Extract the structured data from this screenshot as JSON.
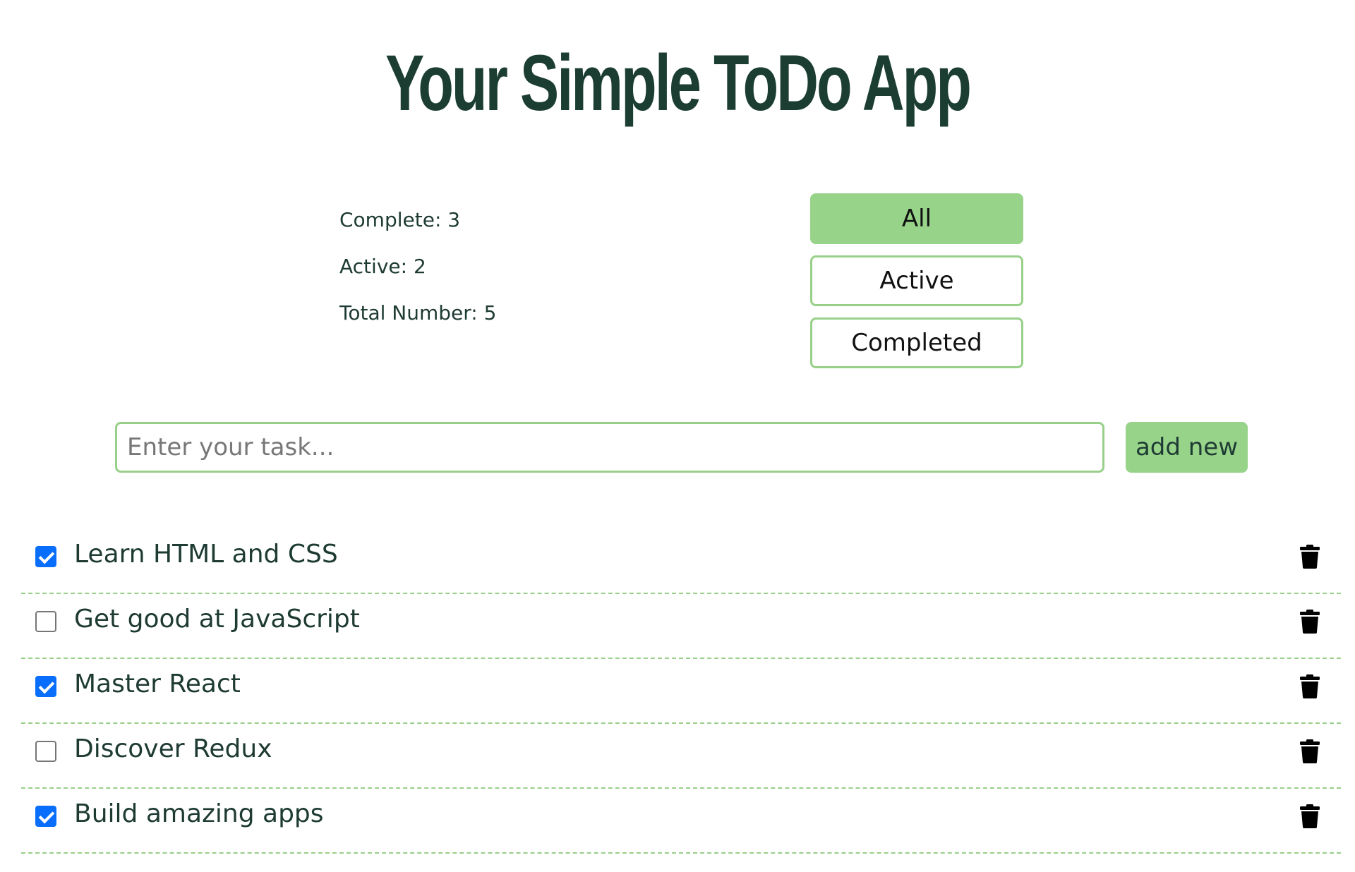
{
  "app": {
    "title": "Your Simple ToDo App"
  },
  "stats": {
    "complete": "Complete: 3",
    "active": "Active: 2",
    "total": "Total Number: 5"
  },
  "filters": {
    "all": "All",
    "active": "Active",
    "completed": "Completed",
    "selected": "All"
  },
  "new_task": {
    "placeholder": "Enter your task...",
    "value": "",
    "add_label": "add new"
  },
  "todos": [
    {
      "text": "Learn HTML and CSS",
      "completed": true,
      "icon": "trash-icon"
    },
    {
      "text": "Get good at JavaScript",
      "completed": false,
      "icon": "trash-icon"
    },
    {
      "text": "Master React",
      "completed": true,
      "icon": "trash-icon"
    },
    {
      "text": "Discover Redux",
      "completed": false,
      "icon": "trash-icon"
    },
    {
      "text": "Build amazing apps",
      "completed": true,
      "icon": "trash-icon"
    }
  ],
  "colors": {
    "title": "#1b3d32",
    "accent": "#98d38a",
    "checkbox_checked": "#0a6efd",
    "text": "#1e3b33"
  }
}
